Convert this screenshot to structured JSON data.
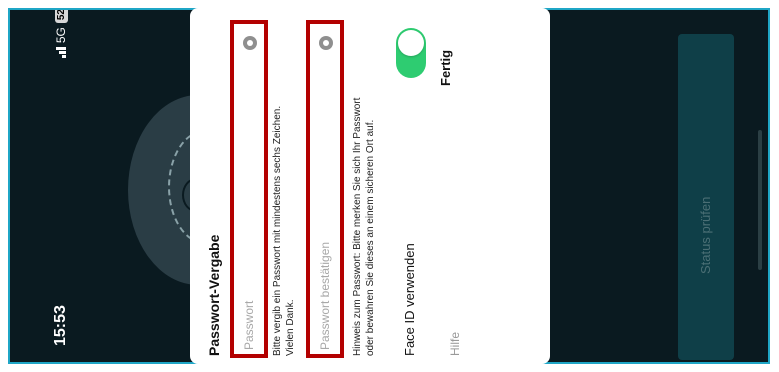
{
  "status_bar": {
    "time": "15:53",
    "network": "5G",
    "battery": "52"
  },
  "background": {
    "status_button_label": "Status prüfen"
  },
  "dialog": {
    "title": "Passwort-Vergabe",
    "password_placeholder": "Passwort",
    "password_hint_line1": "Bitte vergib ein Passwort mit mindestens sechs Zeichen.",
    "password_hint_line2": "Vielen Dank.",
    "confirm_placeholder": "Passwort bestätigen",
    "notice_line1": "Hinweis zum Passwort: Bitte merken Sie sich Ihr Passwort",
    "notice_line2": "oder bewahren Sie dieses an einem sicheren Ort auf.",
    "face_id_label": "Face ID verwenden",
    "face_id_enabled": true,
    "help_label": "Hilfe",
    "done_label": "Fertig"
  },
  "colors": {
    "accent_border": "#1fa6c6",
    "highlight_red": "#b30000",
    "toggle_green": "#2ecc71",
    "background_dark": "#0a1a20"
  }
}
